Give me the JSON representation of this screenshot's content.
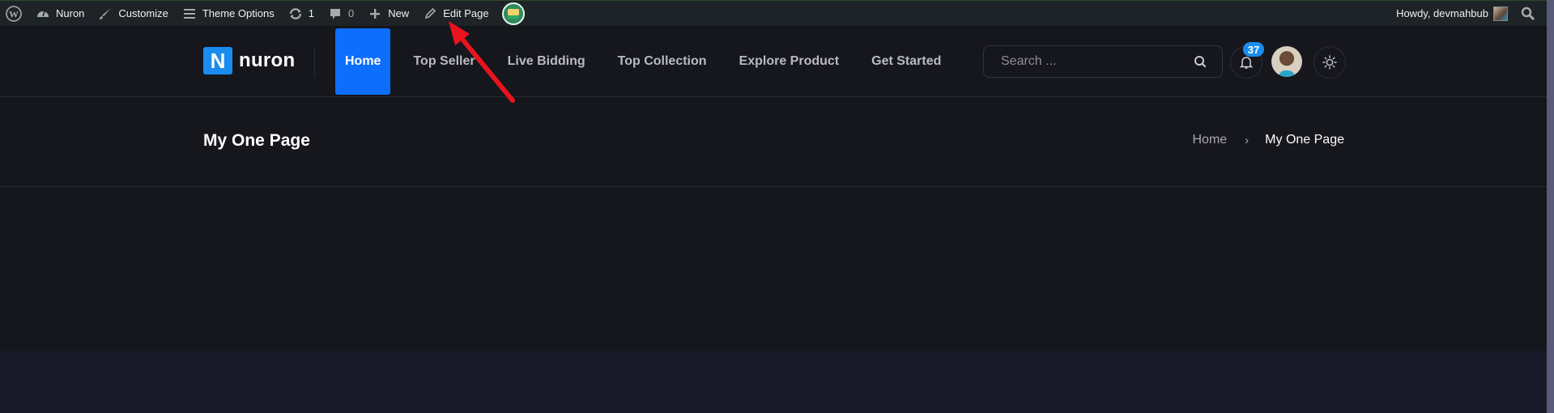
{
  "admin_bar": {
    "wp_logo_icon": "wordpress-icon",
    "site_name": "Nuron",
    "customize": "Customize",
    "theme_options": "Theme Options",
    "updates_count": "1",
    "comments_count": "0",
    "new_label": "New",
    "edit_page": "Edit Page",
    "greeting": "Howdy, devmahbub"
  },
  "header": {
    "logo_letter": "N",
    "logo_text": "nuron",
    "nav": [
      {
        "label": "Home",
        "active": true
      },
      {
        "label": "Top Seller",
        "active": false
      },
      {
        "label": "Live Bidding",
        "active": false
      },
      {
        "label": "Top Collection",
        "active": false
      },
      {
        "label": "Explore Product",
        "active": false
      },
      {
        "label": "Get Started",
        "active": false
      }
    ],
    "search_placeholder": "Search ...",
    "notification_count": "37"
  },
  "title_bar": {
    "page_title": "My One Page",
    "breadcrumb": {
      "home": "Home",
      "separator": "›",
      "current": "My One Page"
    }
  },
  "colors": {
    "accent": "#0d6efd",
    "logo_blue": "#1a8cf0",
    "annotation_arrow": "#e8141c",
    "admin_bar_bg": "#1d2327",
    "page_bg": "#16161d"
  }
}
